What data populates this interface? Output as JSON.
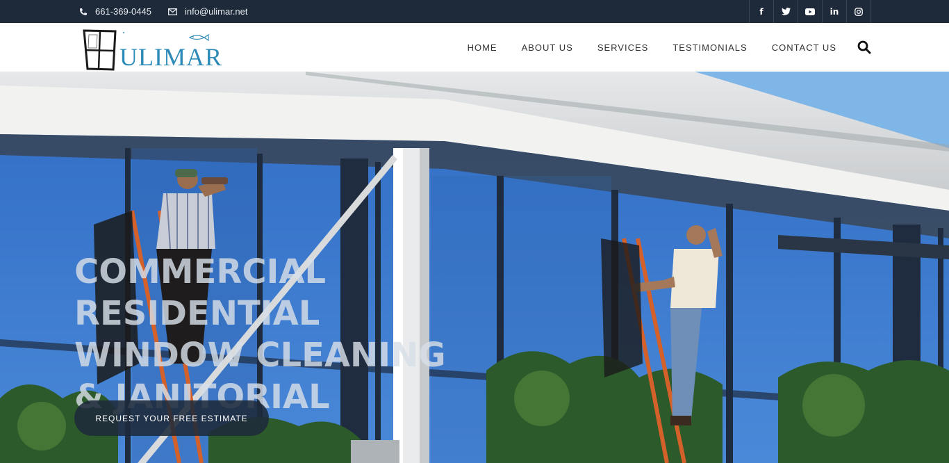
{
  "topbar": {
    "phone": "661-369-0445",
    "email": "info@ulimar.net",
    "social": [
      {
        "icon": "facebook-icon",
        "glyph": "f"
      },
      {
        "icon": "twitter-icon",
        "glyph": "t"
      },
      {
        "icon": "youtube-icon",
        "glyph": "▶"
      },
      {
        "icon": "linkedin-icon",
        "glyph": "in"
      },
      {
        "icon": "instagram-icon",
        "glyph": "◎"
      }
    ]
  },
  "header": {
    "logo_text": "ULIMAR",
    "nav": [
      "HOME",
      "ABOUT US",
      "SERVICES",
      "TESTIMONIALS",
      "CONTACT US"
    ]
  },
  "hero": {
    "lines": [
      "COMMERCIAL",
      "RESIDENTIAL",
      "WINDOW CLEANING",
      "& JANITORIAL"
    ],
    "cta": "REQUEST YOUR FREE ESTIMATE"
  },
  "colors": {
    "topbar": "#1e2a3a",
    "brand": "#2e8bb8",
    "sky": "#3c76c9"
  }
}
